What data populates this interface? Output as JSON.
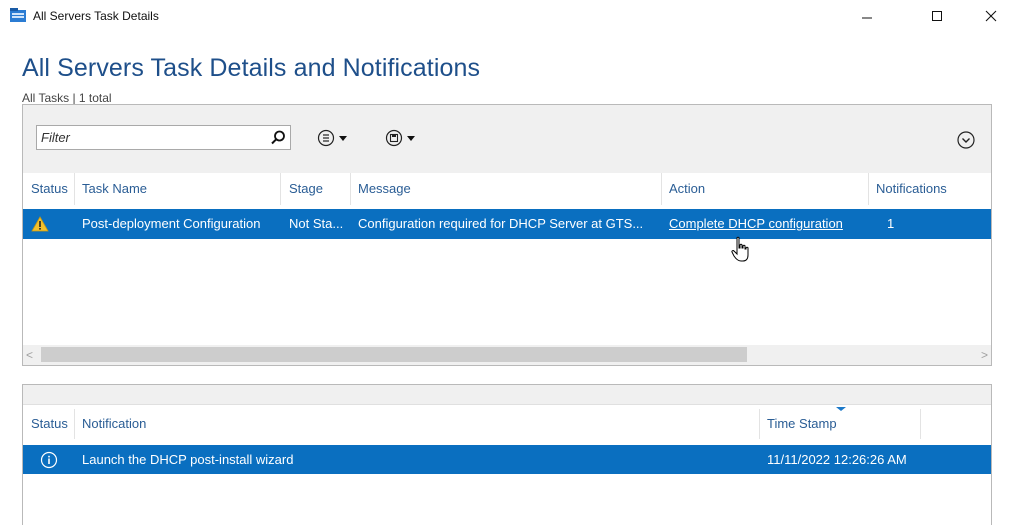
{
  "window": {
    "title": "All Servers Task Details",
    "minimize_glyph": "—",
    "maximize_glyph": "☐",
    "close_glyph": "✕"
  },
  "page": {
    "title": "All Servers Task Details and Notifications",
    "subtitle": "All Tasks | 1 total"
  },
  "toolbar": {
    "filter_placeholder": "Filter",
    "filter_value": "",
    "view_icon": "list-view-icon",
    "save_icon": "save-query-icon",
    "collapse_icon": "chevron-down-circle-icon"
  },
  "tasks": {
    "columns": {
      "status": "Status",
      "task_name": "Task Name",
      "stage": "Stage",
      "message": "Message",
      "action": "Action",
      "notifications": "Notifications"
    },
    "rows": [
      {
        "status_icon": "warning-icon",
        "task_name": "Post-deployment Configuration",
        "stage": "Not Sta...",
        "message": "Configuration required for DHCP Server at GTS...",
        "action": "Complete DHCP configuration",
        "notifications": "1"
      }
    ],
    "scroll_left": "<",
    "scroll_right": ">"
  },
  "notifications": {
    "columns": {
      "status": "Status",
      "notification": "Notification",
      "time_stamp": "Time Stamp"
    },
    "rows": [
      {
        "status_icon": "info-icon",
        "notification": "Launch the DHCP post-install wizard",
        "time_stamp": "11/11/2022 12:26:26 AM"
      }
    ]
  },
  "colors": {
    "accent": "#0a6fc0",
    "title_blue": "#1e4f8a",
    "header_text": "#2a5d95",
    "warning": "#f2c12e"
  }
}
